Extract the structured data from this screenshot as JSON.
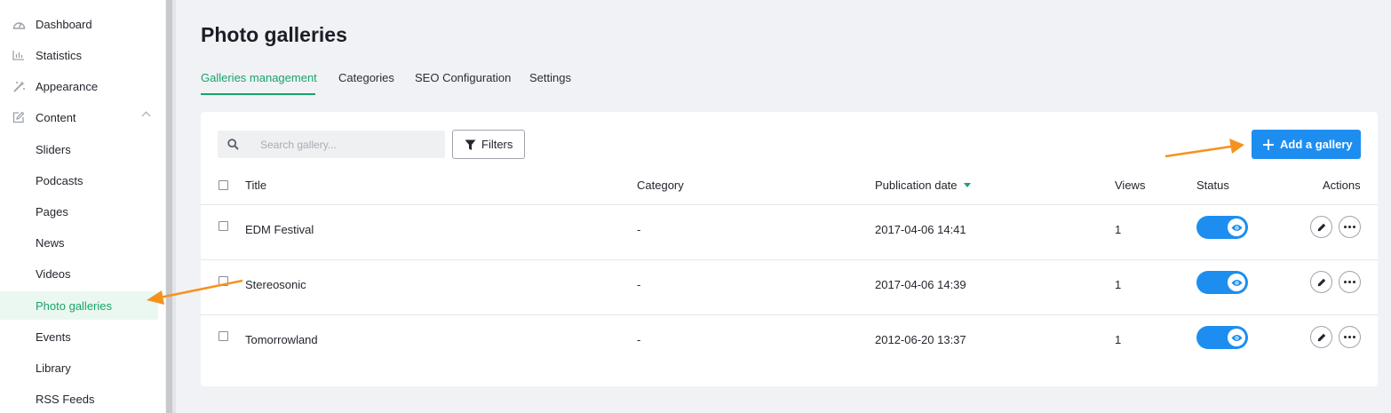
{
  "sidebar": {
    "items": [
      {
        "label": "Dashboard",
        "icon": "dashboard-icon"
      },
      {
        "label": "Statistics",
        "icon": "bar-chart-icon"
      },
      {
        "label": "Appearance",
        "icon": "magic-wand-icon"
      },
      {
        "label": "Content",
        "icon": "edit-icon",
        "expanded": true
      },
      {
        "label": "Sliders"
      },
      {
        "label": "Podcasts"
      },
      {
        "label": "Pages"
      },
      {
        "label": "News"
      },
      {
        "label": "Videos"
      },
      {
        "label": "Photo galleries",
        "active": true
      },
      {
        "label": "Events"
      },
      {
        "label": "Library"
      },
      {
        "label": "RSS Feeds"
      }
    ]
  },
  "page": {
    "title": "Photo galleries"
  },
  "tabs": [
    {
      "label": "Galleries management",
      "active": true
    },
    {
      "label": "Categories"
    },
    {
      "label": "SEO Configuration"
    },
    {
      "label": "Settings"
    }
  ],
  "toolbar": {
    "search_placeholder": "Search gallery...",
    "filters_label": "Filters",
    "add_label": "Add a gallery"
  },
  "table": {
    "columns": [
      "Title",
      "Category",
      "Publication date",
      "Views",
      "Status",
      "Actions"
    ],
    "sorted_column": "Publication date",
    "rows": [
      {
        "title": "EDM Festival",
        "category": "-",
        "date": "2017-04-06 14:41",
        "views": "1",
        "status": "visible"
      },
      {
        "title": "Stereosonic",
        "category": "-",
        "date": "2017-04-06 14:39",
        "views": "1",
        "status": "visible"
      },
      {
        "title": "Tomorrowland",
        "category": "-",
        "date": "2012-06-20 13:37",
        "views": "1",
        "status": "visible"
      }
    ]
  },
  "colors": {
    "accent_green": "#18a46a",
    "primary_blue": "#1d8ef0",
    "annotation_arrow": "#f5921e"
  }
}
